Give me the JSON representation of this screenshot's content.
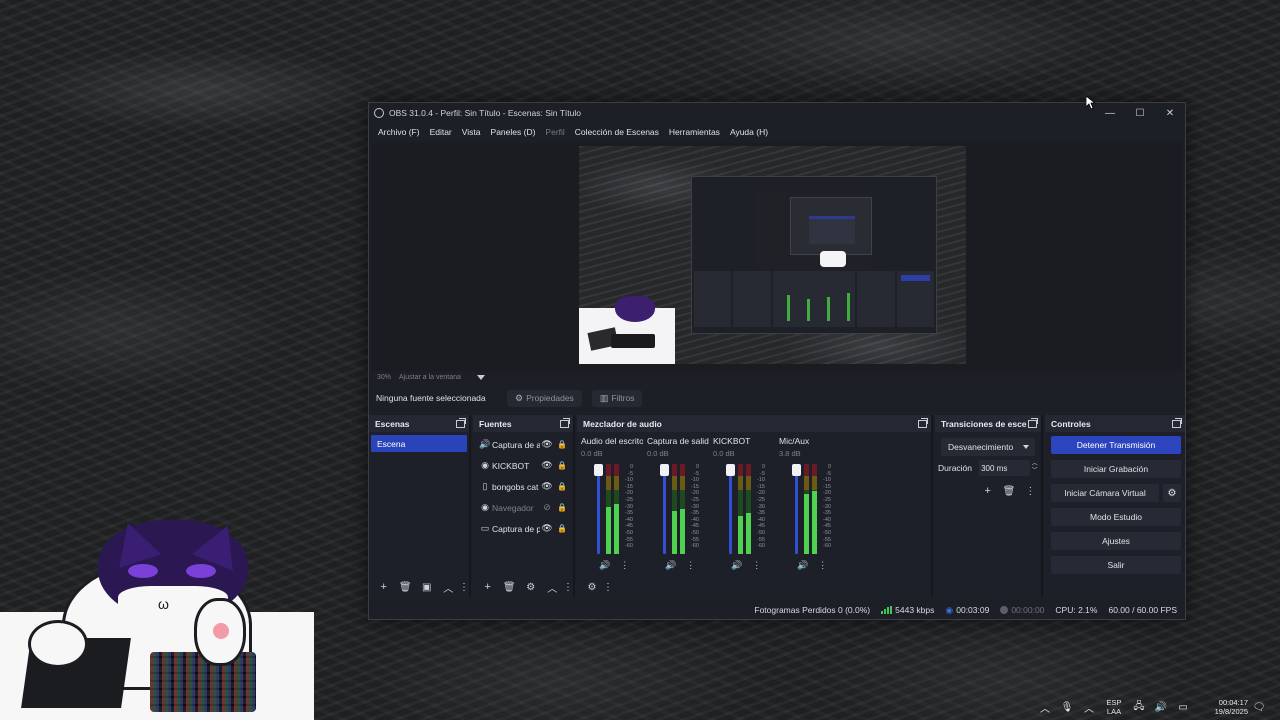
{
  "window": {
    "title": "OBS 31.0.4 - Perfil: Sin Título - Escenas: Sin Título",
    "controls": {
      "minimize": "—",
      "maximize": "☐",
      "close": "✕"
    }
  },
  "menu": {
    "items": [
      {
        "label": "Archivo (F)",
        "enabled": true
      },
      {
        "label": "Editar",
        "enabled": true
      },
      {
        "label": "Vista",
        "enabled": true
      },
      {
        "label": "Paneles (D)",
        "enabled": true
      },
      {
        "label": "Perfil",
        "enabled": false
      },
      {
        "label": "Colección de Escenas",
        "enabled": true
      },
      {
        "label": "Herramientas",
        "enabled": true
      },
      {
        "label": "Ayuda (H)",
        "enabled": true
      }
    ]
  },
  "preview": {
    "zoom": "30%",
    "fit_label": "Ajustar a la ventana"
  },
  "context_bar": {
    "selection": "Ninguna fuente seleccionada",
    "properties_label": "Propiedades",
    "filters_label": "Filtros"
  },
  "scenes": {
    "title": "Escenas",
    "items": [
      {
        "label": "Escena",
        "selected": true
      }
    ]
  },
  "sources": {
    "title": "Fuentes",
    "items": [
      {
        "icon": "speaker-icon",
        "glyph": "🔊",
        "label": "Captura de audio",
        "visible": true
      },
      {
        "icon": "kick-icon",
        "glyph": "◉",
        "label": "KICKBOT",
        "visible": true
      },
      {
        "icon": "document-icon",
        "glyph": "▯",
        "label": "bongobs cat",
        "visible": true
      },
      {
        "icon": "globe-icon",
        "glyph": "◉",
        "label": "Navegador",
        "visible": false
      },
      {
        "icon": "monitor-icon",
        "glyph": "▭",
        "label": "Captura de pantalla",
        "visible": true
      }
    ]
  },
  "mixer": {
    "title": "Mezclador de audio",
    "channels": [
      {
        "name": "Audio del escritorio",
        "db": "0.0 dB",
        "level": 0.55
      },
      {
        "name": "Captura de salida",
        "db": "0.0 dB",
        "level": 0.5
      },
      {
        "name": "KICKBOT",
        "db": "0.0 dB",
        "level": 0.45
      },
      {
        "name": "Mic/Aux",
        "db": "3.8 dB",
        "level": 0.7
      }
    ],
    "scale": [
      "0",
      "-5",
      "-10",
      "-15",
      "-20",
      "-25",
      "-30",
      "-35",
      "-40",
      "-45",
      "-50",
      "-55",
      "-60"
    ]
  },
  "transitions": {
    "title": "Transiciones de escena",
    "selected": "Desvanecimiento",
    "duration_label": "Duración",
    "duration_value": "300 ms"
  },
  "controls": {
    "title": "Controles",
    "stop_stream": "Detener Transmisión",
    "start_recording": "Iniciar Grabación",
    "virtual_camera": "Iniciar Cámara Virtual",
    "studio_mode": "Modo Estudio",
    "settings": "Ajustes",
    "exit": "Salir"
  },
  "statusbar": {
    "dropped_frames": "Fotogramas Perdidos 0 (0.0%)",
    "bitrate": "5443 kbps",
    "stream_time": "00:03:09",
    "record_time": "00:00:00",
    "cpu": "CPU: 2.1%",
    "fps": "60.00 / 60.00 FPS"
  },
  "tray": {
    "lang_top": "ESP",
    "lang_bottom": "LAA",
    "time": "00:04:17",
    "date": "19/8/2025"
  },
  "colors": {
    "accent": "#2c45bf",
    "meter_green": "#4fd24f",
    "window_bg": "#1d1f26"
  }
}
